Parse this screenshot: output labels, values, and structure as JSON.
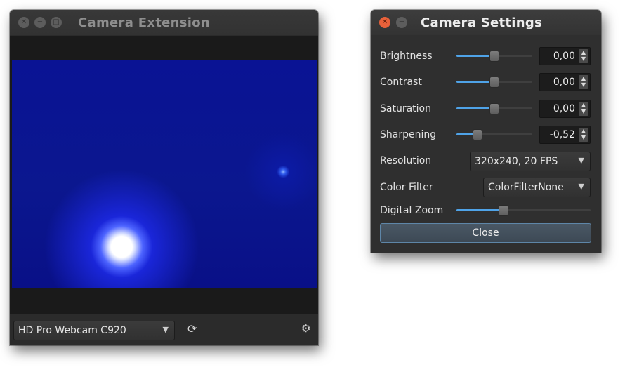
{
  "camera_window": {
    "title": "Camera Extension",
    "device_select": {
      "value": "HD Pro Webcam C920",
      "arrow": "▼"
    },
    "refresh_icon_glyph": "⟳",
    "gear_icon_glyph": "⚙",
    "icons": [
      "close-icon",
      "minimize-icon",
      "maximize-icon",
      "refresh-icon",
      "gear-icon"
    ]
  },
  "settings_window": {
    "title": "Camera Settings",
    "sliders": [
      {
        "label": "Brightness",
        "value": "0,00",
        "level": 0.5
      },
      {
        "label": "Contrast",
        "value": "0,00",
        "level": 0.5
      },
      {
        "label": "Saturation",
        "value": "0,00",
        "level": 0.5
      },
      {
        "label": "Sharpening",
        "value": "-0,52",
        "level": 0.28
      }
    ],
    "resolution": {
      "label": "Resolution",
      "value": "320x240, 20 FPS"
    },
    "color_filter": {
      "label": "Color Filter",
      "value": "ColorFilterNone"
    },
    "digital_zoom": {
      "label": "Digital Zoom",
      "level": 0.35
    },
    "close_label": "Close",
    "spin_arrows": "▲▼"
  },
  "colors": {
    "accent": "#4fa3e8",
    "close_button_red": "#e8613a",
    "window_bg": "#2f2f2f"
  }
}
